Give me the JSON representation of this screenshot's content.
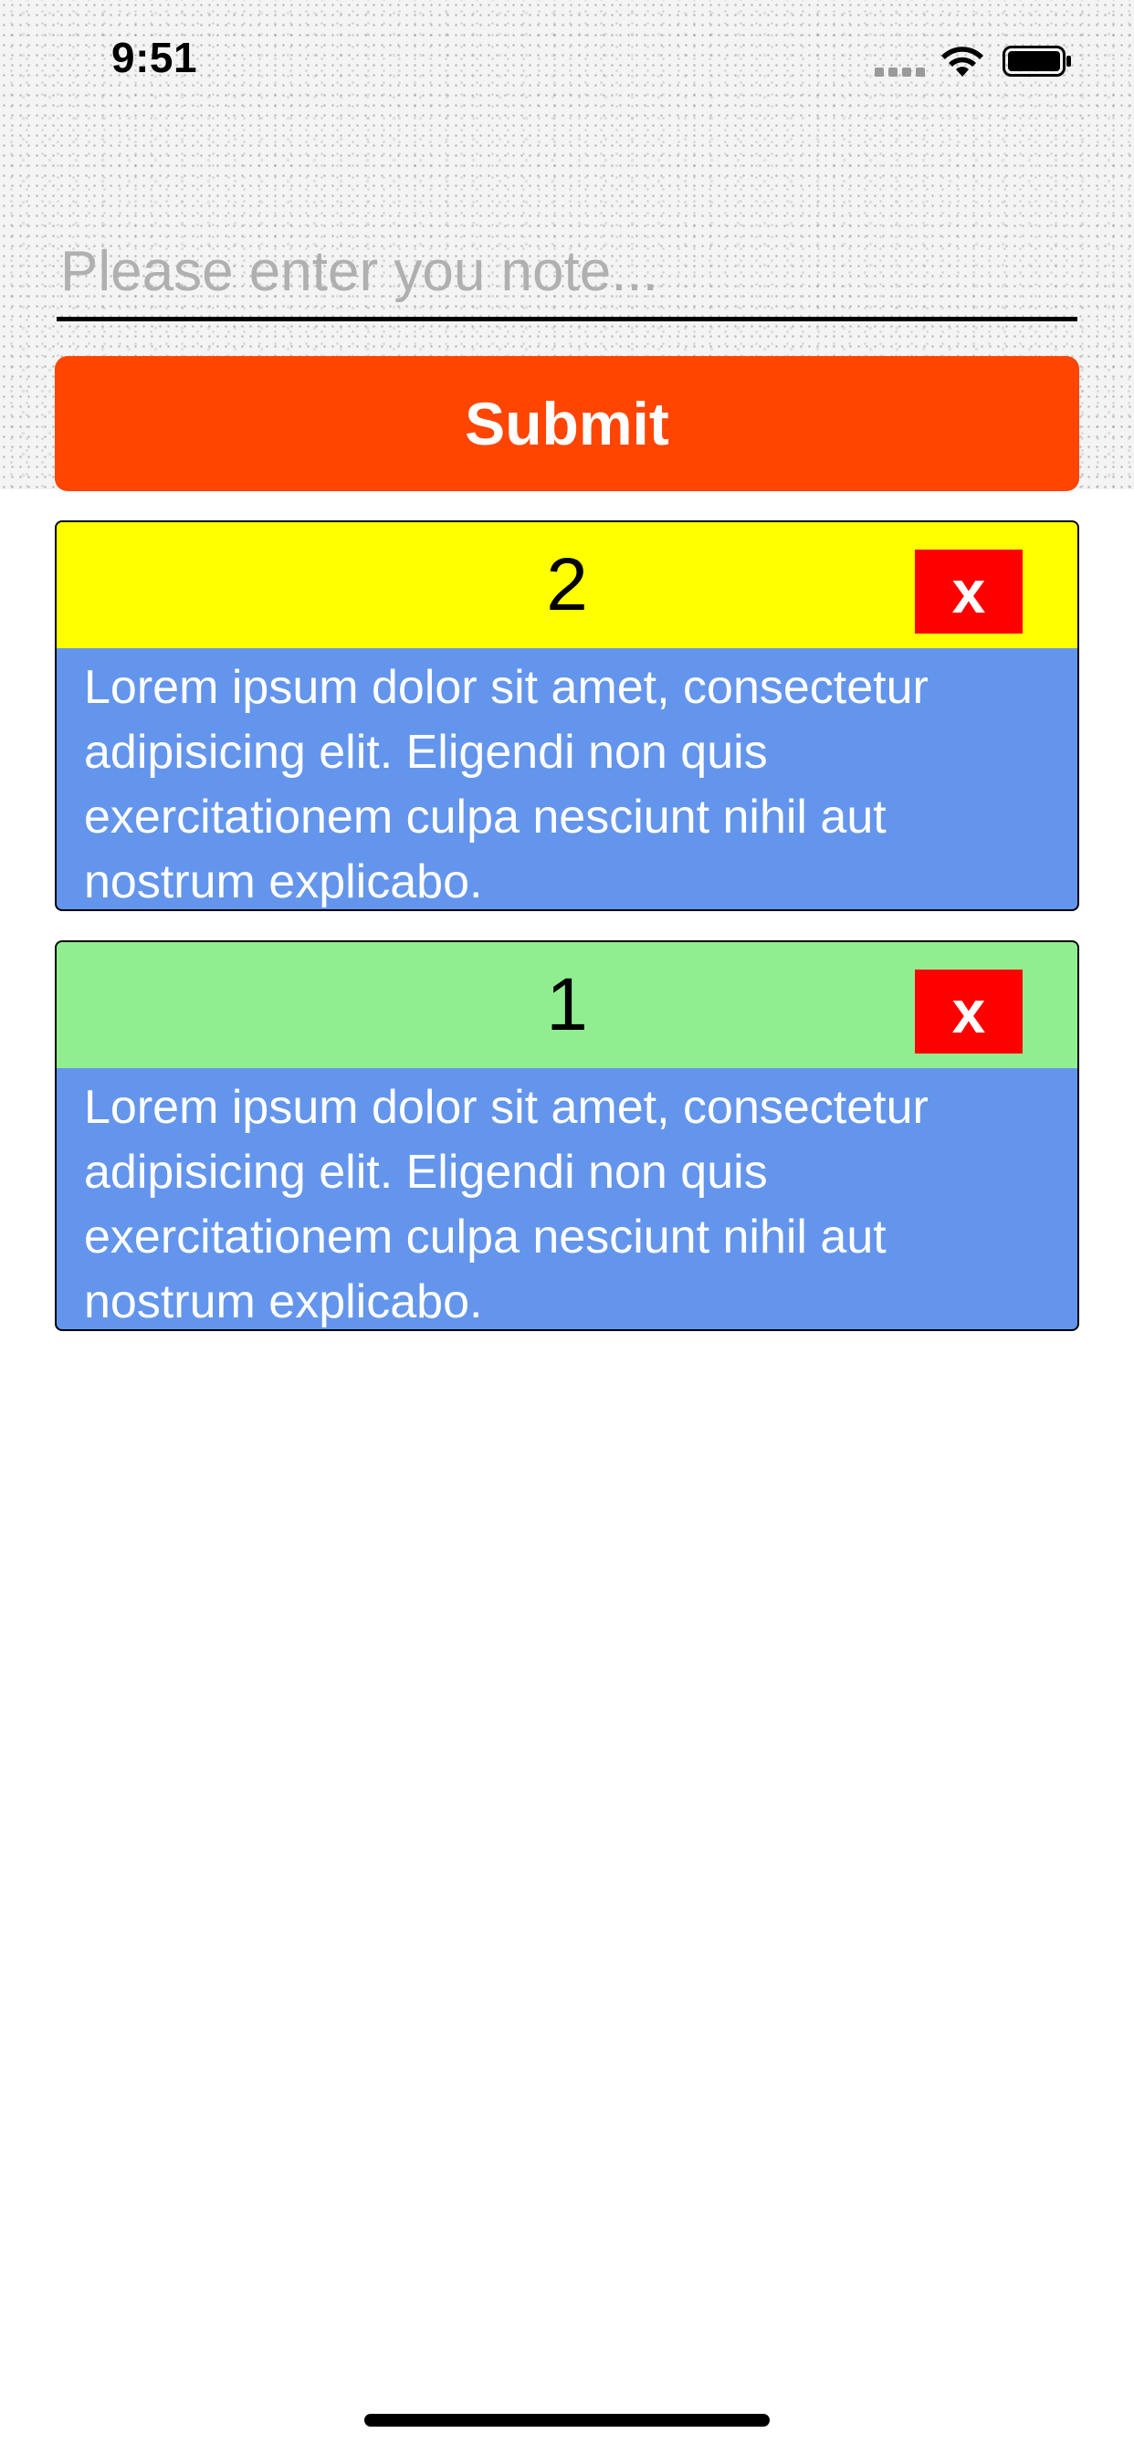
{
  "status_bar": {
    "time": "9:51"
  },
  "note_form": {
    "placeholder": "Please enter you note...",
    "value": "",
    "submit_label": "Submit",
    "submit_color": "#ff4500"
  },
  "notes": [
    {
      "number": "2",
      "header_color": "#ffff00",
      "delete_label": "x",
      "body": "Lorem ipsum dolor sit amet, consectetur adipisicing elit. Eligendi non quis exercitationem culpa nesciunt nihil aut nostrum explicabo."
    },
    {
      "number": "1",
      "header_color": "#90ee90",
      "delete_label": "x",
      "body": "Lorem ipsum dolor sit amet, consectetur adipisicing elit. Eligendi non quis exercitationem culpa nesciunt nihil aut nostrum explicabo."
    }
  ],
  "colors": {
    "card_body": "#6495ed",
    "delete_button": "#ff0000"
  },
  "icons": {
    "signal": "cellular-signal-icon",
    "wifi": "wifi-icon",
    "battery": "battery-icon"
  }
}
